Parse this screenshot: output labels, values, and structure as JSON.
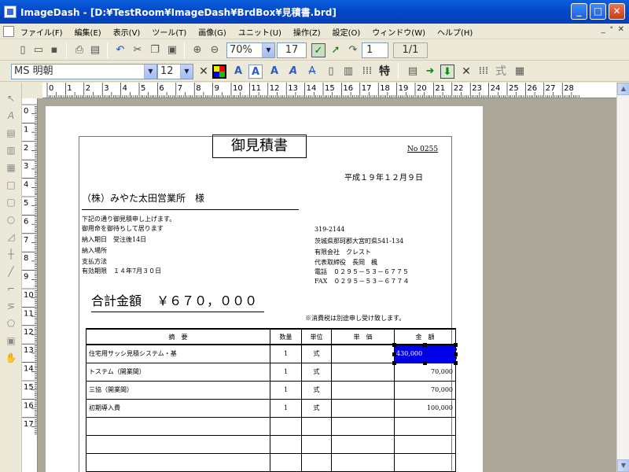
{
  "window": {
    "title": "ImageDash - [D:¥TestRoom¥ImageDash¥BrdBox¥見積書.brd]",
    "controls": [
      "_",
      "□",
      "✕"
    ]
  },
  "menu": {
    "items": [
      "ファイル(F)",
      "編集(E)",
      "表示(V)",
      "ツール(T)",
      "画像(G)",
      "ユニット(U)",
      "操作(Z)",
      "設定(O)",
      "ウィンドウ(W)",
      "ヘルプ(H)"
    ],
    "mdi_controls": [
      "_",
      "ᐤ",
      "✕"
    ]
  },
  "toolbar1": {
    "zoom": "70%",
    "grid_size": "17",
    "page_number": "1",
    "page_total": "1/1"
  },
  "toolbar2": {
    "font_name": "MS 明朝",
    "font_size": "12",
    "special_char": "特",
    "shiki_label": "式"
  },
  "ruler": {
    "h_marks": [
      "0",
      "1",
      "2",
      "3",
      "4",
      "5",
      "6",
      "7",
      "8",
      "9",
      "10",
      "11",
      "12",
      "13",
      "14",
      "15",
      "16",
      "17",
      "18",
      "19",
      "20",
      "21",
      "22",
      "23",
      "24",
      "25",
      "26",
      "27",
      "28"
    ],
    "v_marks": [
      "0",
      "1",
      "2",
      "3",
      "4",
      "5",
      "6",
      "7",
      "8",
      "9",
      "10",
      "11",
      "12",
      "13",
      "14",
      "15",
      "16",
      "17"
    ]
  },
  "document": {
    "title": "御見積書",
    "number": "No 0255",
    "date": "平成１９年１２月９日",
    "recipient": "（株）みやた太田営業所　様",
    "intro": "下記の通り御見積申し上げます。",
    "conditions": [
      "御用命を御待ちして居ります",
      "納入期日　受注後14日",
      "納入場所",
      "支払方法",
      "有効期限　１４年7月３０日"
    ],
    "sender": [
      "319-2144",
      "茨城県那珂郡大宮町県541-134",
      "有限会社　クレスト",
      "代表取締役　長岡　楓",
      "電話　０２９５－５３－６７７５",
      "FAX　０２９５－５３－６７７４"
    ],
    "total_label": "合計金額",
    "total_value": "￥６７０，０００",
    "tax_note": "※消費税は別途申し受け致します。",
    "table": {
      "headers": [
        "摘　要",
        "数量",
        "単位",
        "単　価",
        "金　額"
      ],
      "rows": [
        {
          "desc": "住宅用サッシ見積システム・基",
          "qty": "1",
          "unit": "式",
          "price": "",
          "amount": "430,000"
        },
        {
          "desc": "トステム（開業間）",
          "qty": "1",
          "unit": "式",
          "price": "",
          "amount": "70,000"
        },
        {
          "desc": "三協（開業間）",
          "qty": "1",
          "unit": "式",
          "price": "",
          "amount": "70,000"
        },
        {
          "desc": "初期導入費",
          "qty": "1",
          "unit": "式",
          "price": "",
          "amount": "100,000"
        },
        {
          "desc": "",
          "qty": "",
          "unit": "",
          "price": "",
          "amount": ""
        },
        {
          "desc": "",
          "qty": "",
          "unit": "",
          "price": "",
          "amount": ""
        },
        {
          "desc": "",
          "qty": "",
          "unit": "",
          "price": "",
          "amount": ""
        }
      ]
    }
  }
}
